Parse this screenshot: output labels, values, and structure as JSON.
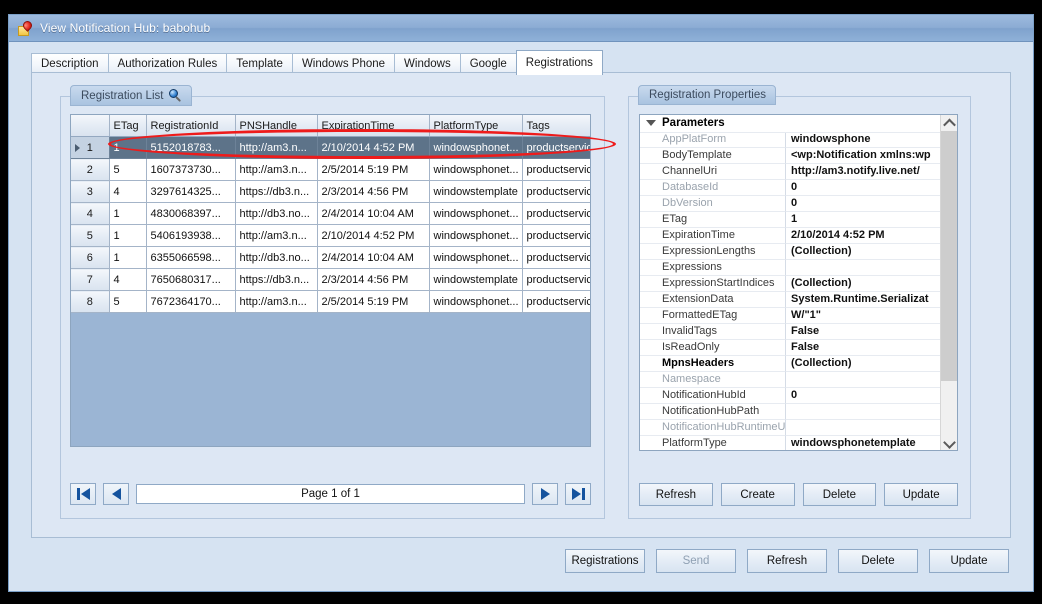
{
  "window": {
    "title": "View Notification Hub: babohub",
    "icon": "notification-hub-icon"
  },
  "tabs": [
    {
      "label": "Description",
      "selected": false
    },
    {
      "label": "Authorization Rules",
      "selected": false
    },
    {
      "label": "Template",
      "selected": false
    },
    {
      "label": "Windows Phone",
      "selected": false
    },
    {
      "label": "Windows",
      "selected": false
    },
    {
      "label": "Google",
      "selected": false
    },
    {
      "label": "Registrations",
      "selected": true
    }
  ],
  "registration_list": {
    "caption": "Registration List",
    "caption_icon": "magnifier-icon",
    "columns": [
      "",
      "ETag",
      "RegistrationId",
      "PNSHandle",
      "ExpirationTime",
      "PlatformType",
      "Tags"
    ],
    "rows": [
      {
        "num": "1",
        "etag": "1",
        "registrationId": "5152018783...",
        "pnsHandle": "http://am3.n...",
        "expirationTime": "2/10/2014 4:52 PM",
        "platformType": "windowsphonet...",
        "tags": "productservice",
        "selected": true
      },
      {
        "num": "2",
        "etag": "5",
        "registrationId": "1607373730...",
        "pnsHandle": "http://am3.n...",
        "expirationTime": "2/5/2014 5:19 PM",
        "platformType": "windowsphonet...",
        "tags": "productservice",
        "selected": false
      },
      {
        "num": "3",
        "etag": "4",
        "registrationId": "3297614325...",
        "pnsHandle": "https://db3.n...",
        "expirationTime": "2/3/2014 4:56 PM",
        "platformType": "windowstemplate",
        "tags": "productservice",
        "selected": false
      },
      {
        "num": "4",
        "etag": "1",
        "registrationId": "4830068397...",
        "pnsHandle": "http://db3.no...",
        "expirationTime": "2/4/2014 10:04 AM",
        "platformType": "windowsphonet...",
        "tags": "productservice",
        "selected": false
      },
      {
        "num": "5",
        "etag": "1",
        "registrationId": "5406193938...",
        "pnsHandle": "http://am3.n...",
        "expirationTime": "2/10/2014 4:52 PM",
        "platformType": "windowsphonet...",
        "tags": "productservice",
        "selected": false
      },
      {
        "num": "6",
        "etag": "1",
        "registrationId": "6355066598...",
        "pnsHandle": "http://db3.no...",
        "expirationTime": "2/4/2014 10:04 AM",
        "platformType": "windowsphonet...",
        "tags": "productservice",
        "selected": false
      },
      {
        "num": "7",
        "etag": "4",
        "registrationId": "7650680317...",
        "pnsHandle": "https://db3.n...",
        "expirationTime": "2/3/2014 4:56 PM",
        "platformType": "windowstemplate",
        "tags": "productservice",
        "selected": false
      },
      {
        "num": "8",
        "etag": "5",
        "registrationId": "7672364170...",
        "pnsHandle": "http://am3.n...",
        "expirationTime": "2/5/2014 5:19 PM",
        "platformType": "windowsphonet...",
        "tags": "productservice",
        "selected": false
      }
    ]
  },
  "pager": {
    "first_label": "first-page",
    "prev_label": "previous-page",
    "page_text": "Page 1 of 1",
    "next_label": "next-page",
    "last_label": "last-page"
  },
  "registration_properties": {
    "caption": "Registration Properties",
    "group_header": "Parameters",
    "rows": [
      {
        "name": "AppPlatForm",
        "value": "windowsphone",
        "style": "dim"
      },
      {
        "name": "BodyTemplate",
        "value": "<wp:Notification xmlns:wp",
        "style": "normal"
      },
      {
        "name": "ChannelUri",
        "value": "http://am3.notify.live.net/",
        "style": "normal"
      },
      {
        "name": "DatabaseId",
        "value": "0",
        "style": "dim"
      },
      {
        "name": "DbVersion",
        "value": "0",
        "style": "dim"
      },
      {
        "name": "ETag",
        "value": "1",
        "style": "normal"
      },
      {
        "name": "ExpirationTime",
        "value": "2/10/2014 4:52 PM",
        "style": "normal"
      },
      {
        "name": "ExpressionLengths",
        "value": "(Collection)",
        "style": "normal"
      },
      {
        "name": "Expressions",
        "value": "",
        "style": "normal"
      },
      {
        "name": "ExpressionStartIndices",
        "value": "(Collection)",
        "style": "normal"
      },
      {
        "name": "ExtensionData",
        "value": "System.Runtime.Serializat",
        "style": "normal"
      },
      {
        "name": "FormattedETag",
        "value": "W/\"1\"",
        "style": "normal"
      },
      {
        "name": "InvalidTags",
        "value": "False",
        "style": "normal"
      },
      {
        "name": "IsReadOnly",
        "value": "False",
        "style": "normal"
      },
      {
        "name": "MpnsHeaders",
        "value": "(Collection)",
        "style": "bold"
      },
      {
        "name": "Namespace",
        "value": "",
        "style": "dim"
      },
      {
        "name": "NotificationHubId",
        "value": "0",
        "style": "normal"
      },
      {
        "name": "NotificationHubPath",
        "value": "",
        "style": "normal"
      },
      {
        "name": "NotificationHubRuntimeUr",
        "value": "",
        "style": "dim"
      },
      {
        "name": "PlatformType",
        "value": "windowsphonetemplate",
        "style": "normal"
      }
    ],
    "buttons": [
      {
        "label": "Refresh",
        "disabled": false
      },
      {
        "label": "Create",
        "disabled": false
      },
      {
        "label": "Delete",
        "disabled": false
      },
      {
        "label": "Update",
        "disabled": false
      }
    ]
  },
  "bottom_buttons": [
    {
      "label": "Registrations",
      "disabled": false
    },
    {
      "label": "Send",
      "disabled": true
    },
    {
      "label": "Refresh",
      "disabled": false
    },
    {
      "label": "Delete",
      "disabled": false
    },
    {
      "label": "Update",
      "disabled": false
    }
  ],
  "annotation": {
    "type": "red-ellipse-highlight",
    "target": "grid-column-headers",
    "color": "#ee1b1b"
  }
}
